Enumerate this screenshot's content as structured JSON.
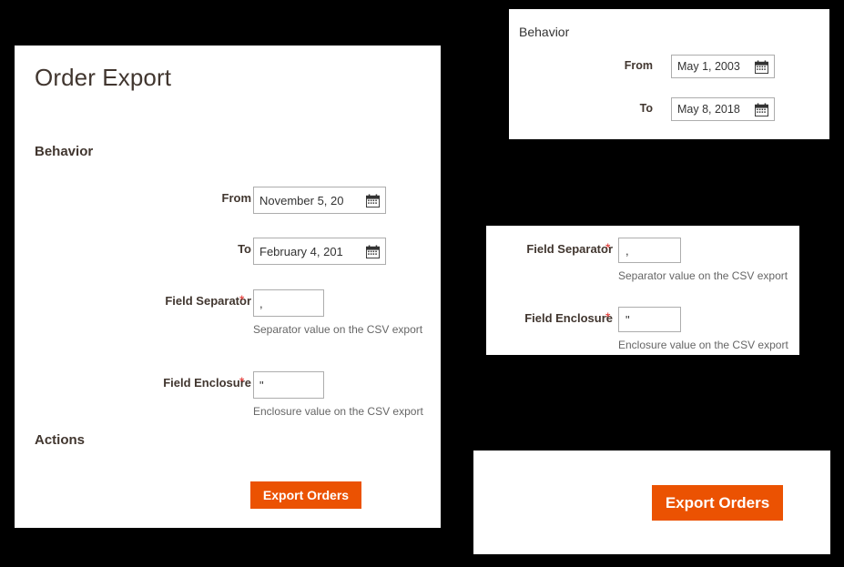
{
  "theme": {
    "background": "#000000",
    "panel_bg": "#ffffff",
    "accent_orange": "#eb5202",
    "required_red": "#e02b27",
    "heading_color": "#41362f",
    "help_text_color": "#666666",
    "input_border": "#adadad"
  },
  "main_panel": {
    "title": "Order Export",
    "behavior_heading": "Behavior",
    "actions_heading": "Actions",
    "fields": {
      "from": {
        "label": "From",
        "value": "November 5, 20",
        "icon": "calendar-icon"
      },
      "to": {
        "label": "To",
        "value": "February 4, 201",
        "icon": "calendar-icon"
      },
      "field_separator": {
        "label": "Field Separator",
        "required_marker": "*",
        "value": ",",
        "help": "Separator value on the CSV export"
      },
      "field_enclosure": {
        "label": "Field Enclosure",
        "required_marker": "*",
        "value": "\"",
        "help": "Enclosure value on the CSV export"
      }
    },
    "export_button": "Export Orders"
  },
  "detail_behavior_panel": {
    "heading": "Behavior",
    "fields": {
      "from": {
        "label": "From",
        "value": "May 1, 2003",
        "icon": "calendar-icon"
      },
      "to": {
        "label": "To",
        "value": "May 8, 2018",
        "icon": "calendar-icon"
      }
    }
  },
  "detail_fields_panel": {
    "field_separator": {
      "label": "Field Separator",
      "required_marker": "*",
      "value": ",",
      "help": "Separator value on the CSV export"
    },
    "field_enclosure": {
      "label": "Field Enclosure",
      "required_marker": "*",
      "value": "\"",
      "help": "Enclosure value on the CSV export"
    }
  },
  "detail_action_panel": {
    "export_button": "Export Orders"
  }
}
